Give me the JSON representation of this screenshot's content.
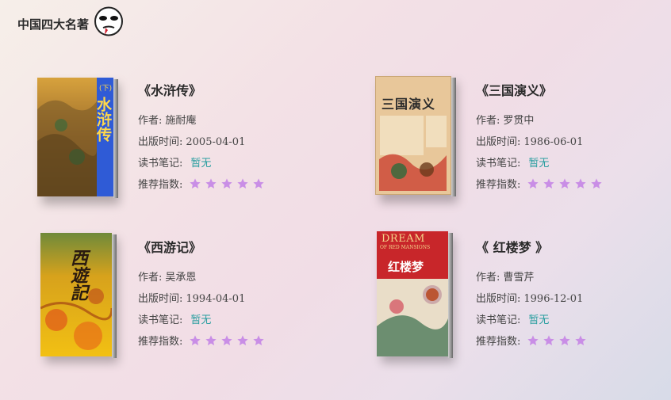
{
  "header": {
    "title": "中国四大名著",
    "logo_icon": "meme-face-icon"
  },
  "labels": {
    "author": "作者:",
    "published": "出版时间:",
    "notes": "读书笔记:",
    "rating": "推荐指数:"
  },
  "books": [
    {
      "title": "《水浒传》",
      "author": "施耐庵",
      "published": "2005-04-01",
      "notes": "暂无",
      "rating": 5,
      "cover": {
        "text": "水浒传",
        "tag": "(下)",
        "accent": "#2f5bd6"
      }
    },
    {
      "title": "《三国演义》",
      "author": "罗贯中",
      "published": "1986-06-01",
      "notes": "暂无",
      "rating": 5,
      "cover": {
        "text": "三国演义",
        "accent": "#e8c79a"
      }
    },
    {
      "title": "《西游记》",
      "author": "吴承恩",
      "published": "1994-04-01",
      "notes": "暂无",
      "rating": 5,
      "cover": {
        "text": "西遊記",
        "accent": "#e0a21a"
      }
    },
    {
      "title": "《 红楼梦 》",
      "author": "曹雪芹",
      "published": "1996-12-01",
      "notes": "暂无",
      "rating": 4,
      "cover": {
        "text": "红楼梦",
        "banner": "DREAM",
        "banner2": "OF RED MANSIONS",
        "accent": "#c8262a"
      }
    }
  ],
  "colors": {
    "star": "#c98ee6",
    "note": "#2a9ea0"
  }
}
